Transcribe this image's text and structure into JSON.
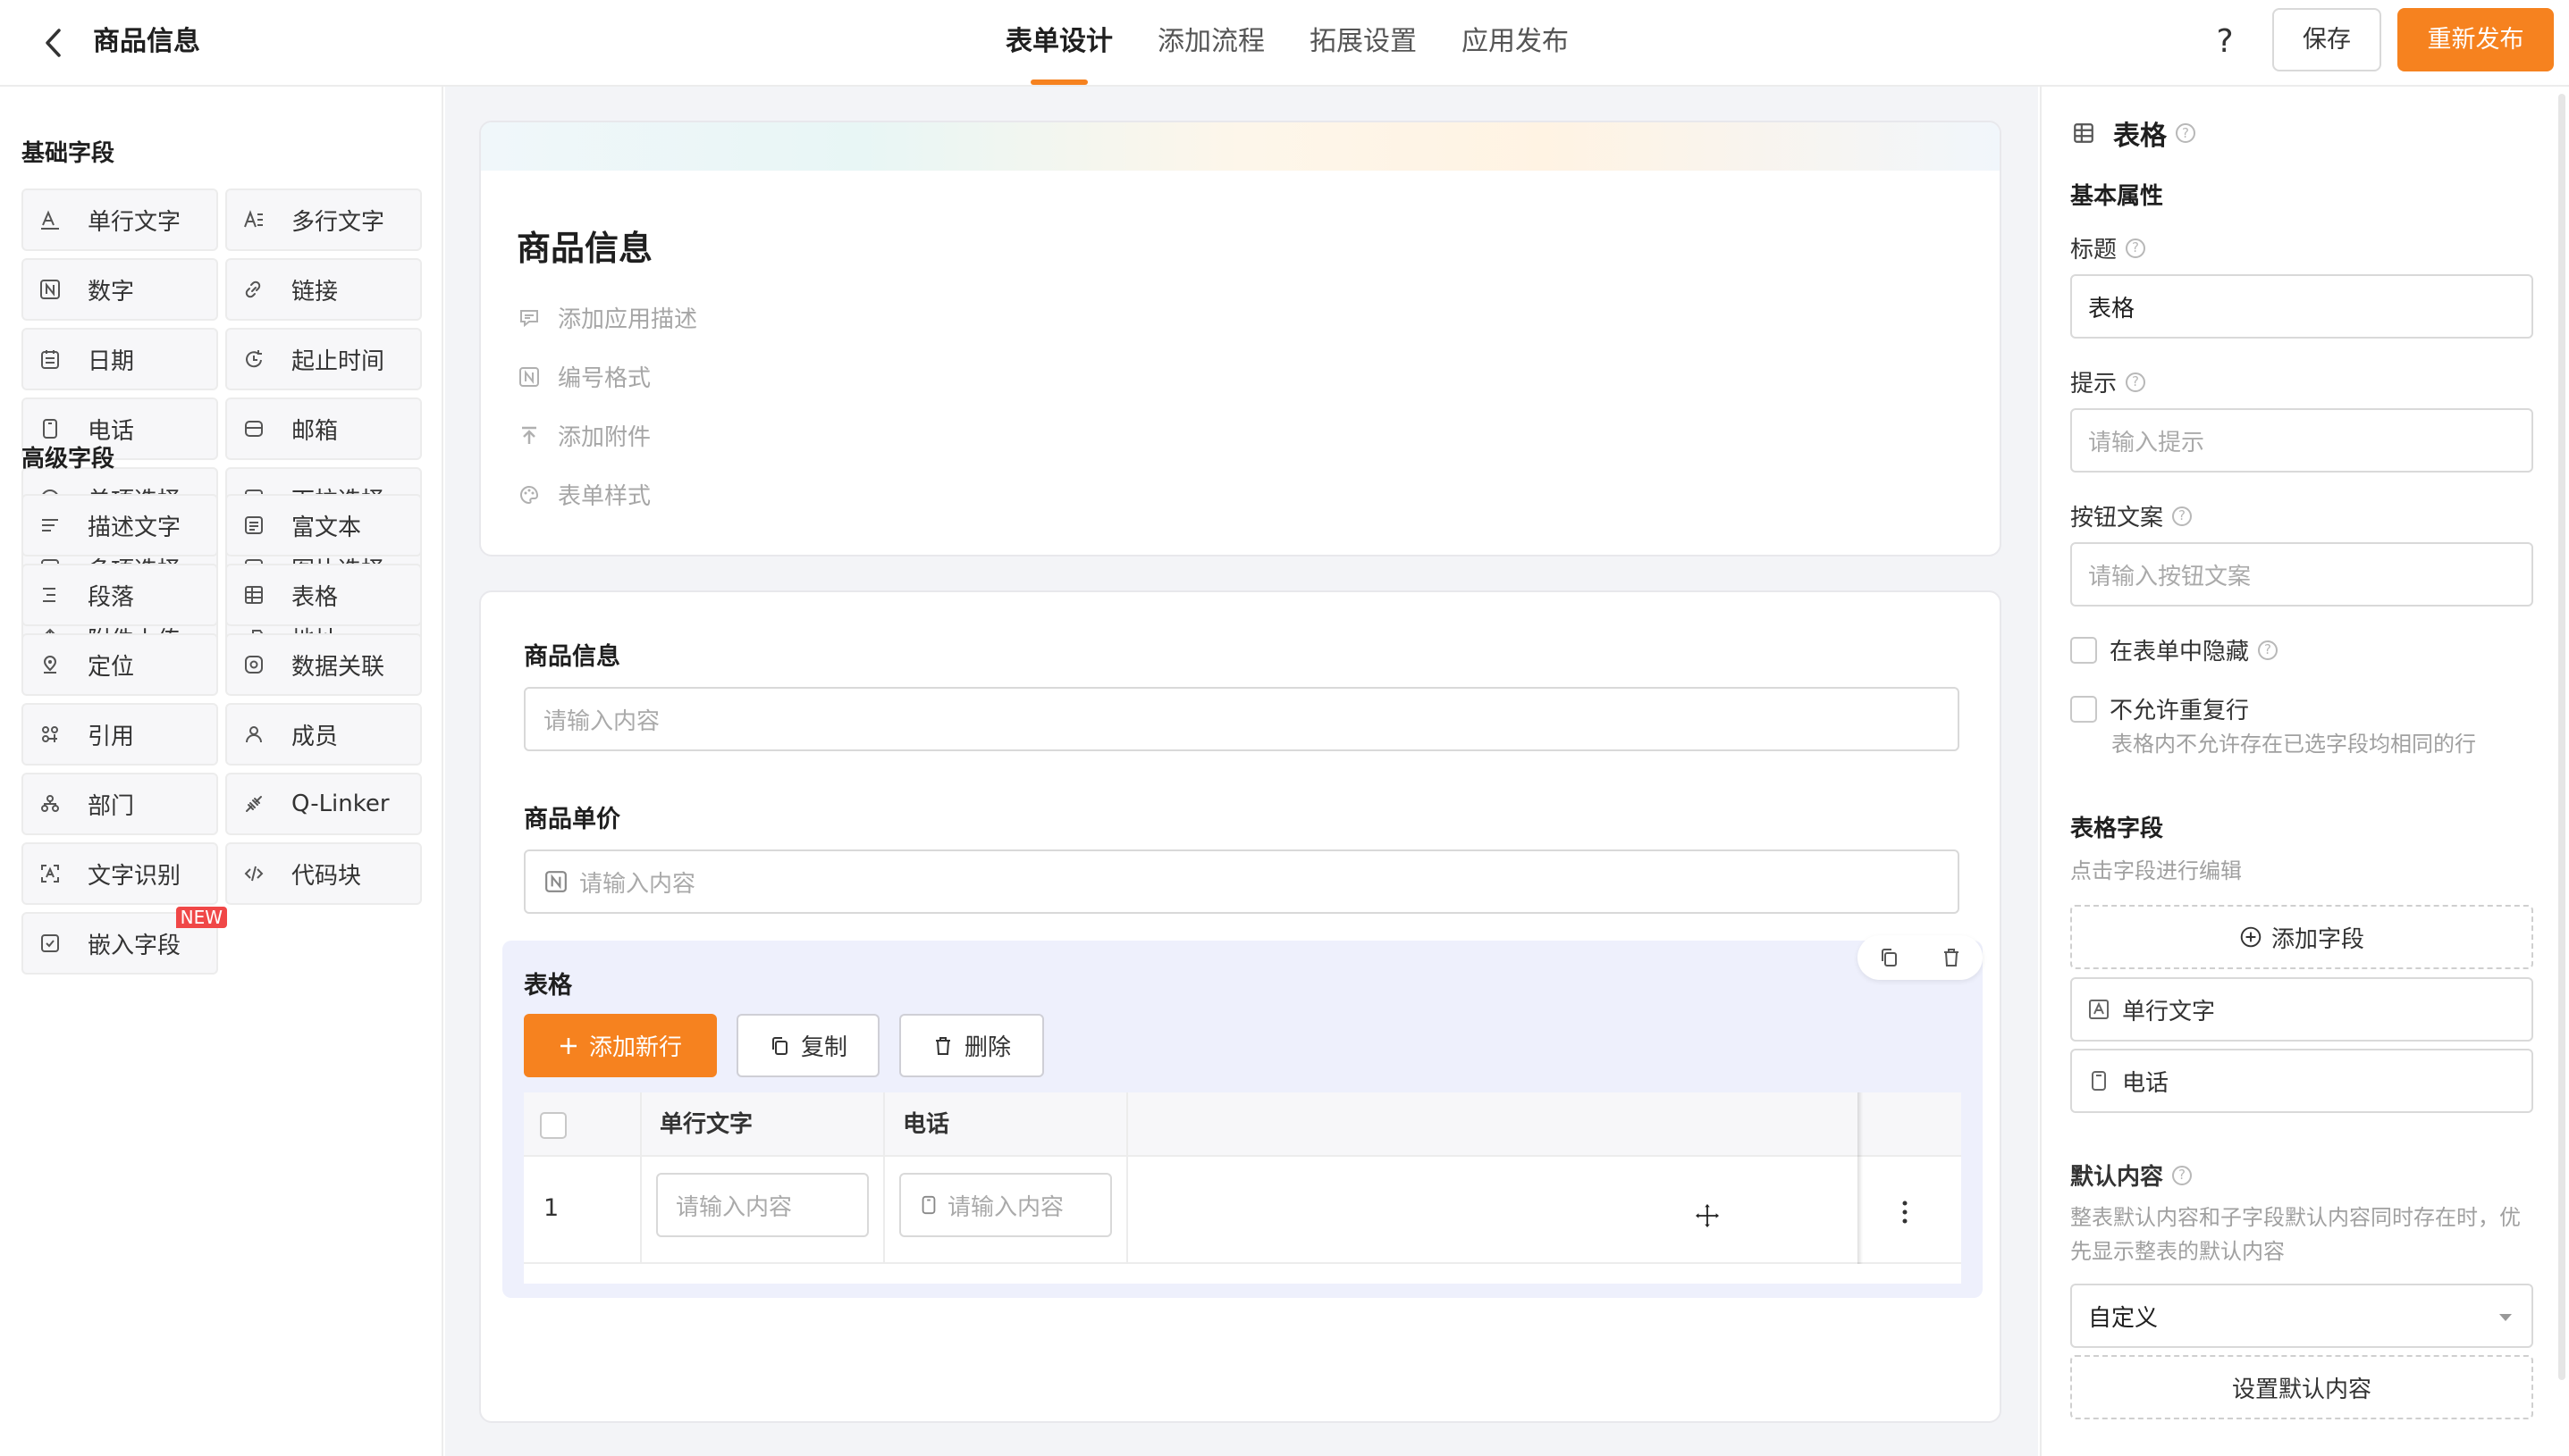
{
  "header": {
    "app_title": "商品信息",
    "tabs": [
      {
        "label": "表单设计",
        "active": true
      },
      {
        "label": "添加流程",
        "active": false
      },
      {
        "label": "拓展设置",
        "active": false
      },
      {
        "label": "应用发布",
        "active": false
      }
    ],
    "help_label": "?",
    "save_label": "保存",
    "publish_label": "重新发布",
    "accent_color": "#f6821f"
  },
  "left_panel": {
    "basic_title": "基础字段",
    "basic_fields": [
      {
        "label": "单行文字",
        "icon": "single-line-text-icon"
      },
      {
        "label": "多行文字",
        "icon": "multi-line-text-icon"
      },
      {
        "label": "数字",
        "icon": "number-icon"
      },
      {
        "label": "链接",
        "icon": "link-icon"
      },
      {
        "label": "日期",
        "icon": "date-icon"
      },
      {
        "label": "起止时间",
        "icon": "time-range-icon"
      },
      {
        "label": "电话",
        "icon": "phone-icon"
      },
      {
        "label": "邮箱",
        "icon": "mail-icon"
      },
      {
        "label": "单项选择",
        "icon": "radio-icon"
      },
      {
        "label": "下拉选择",
        "icon": "dropdown-icon"
      },
      {
        "label": "多项选择",
        "icon": "checkbox-icon"
      },
      {
        "label": "图片选择",
        "icon": "image-icon"
      },
      {
        "label": "附件上传",
        "icon": "upload-icon"
      },
      {
        "label": "地址",
        "icon": "address-icon"
      }
    ],
    "advanced_title": "高级字段",
    "advanced_fields": [
      {
        "label": "描述文字",
        "icon": "description-icon"
      },
      {
        "label": "富文本",
        "icon": "rich-text-icon"
      },
      {
        "label": "段落",
        "icon": "paragraph-icon"
      },
      {
        "label": "表格",
        "icon": "table-icon"
      },
      {
        "label": "定位",
        "icon": "location-icon"
      },
      {
        "label": "数据关联",
        "icon": "data-link-icon"
      },
      {
        "label": "引用",
        "icon": "reference-icon"
      },
      {
        "label": "成员",
        "icon": "member-icon"
      },
      {
        "label": "部门",
        "icon": "department-icon"
      },
      {
        "label": "Q-Linker",
        "icon": "q-linker-icon"
      },
      {
        "label": "文字识别",
        "icon": "ocr-icon"
      },
      {
        "label": "代码块",
        "icon": "code-icon"
      },
      {
        "label": "嵌入字段",
        "icon": "embed-icon",
        "badge": "NEW"
      }
    ]
  },
  "canvas": {
    "form_title": "商品信息",
    "meta": [
      {
        "label": "添加应用描述",
        "icon": "comment-icon"
      },
      {
        "label": "编号格式",
        "icon": "number-format-icon"
      },
      {
        "label": "添加附件",
        "icon": "attachment-upload-icon"
      },
      {
        "label": "表单样式",
        "icon": "palette-icon"
      }
    ],
    "fields": [
      {
        "label": "商品信息",
        "placeholder": "请输入内容"
      },
      {
        "label": "商品单价",
        "placeholder": "请输入内容"
      }
    ],
    "table": {
      "label": "表格",
      "add_row_label": "添加新行",
      "copy_label": "复制",
      "delete_label": "删除",
      "columns": [
        "单行文字",
        "电话"
      ],
      "rows": [
        {
          "index": "1",
          "cells": [
            "请输入内容",
            "请输入内容"
          ]
        }
      ]
    }
  },
  "right_panel": {
    "title": "表格",
    "basic_section": "基本属性",
    "title_label": "标题",
    "title_value": "表格",
    "hint_label": "提示",
    "hint_placeholder": "请输入提示",
    "button_text_label": "按钮文案",
    "button_text_placeholder": "请输入按钮文案",
    "hide_in_form": "在表单中隐藏",
    "no_duplicate": "不允许重复行",
    "no_duplicate_hint": "表格内不允许存在已选字段均相同的行",
    "table_fields_section": "表格字段",
    "table_fields_hint": "点击字段进行编辑",
    "add_field_label": "添加字段",
    "table_fields": [
      {
        "label": "单行文字",
        "icon": "single-line-text-icon"
      },
      {
        "label": "电话",
        "icon": "phone-icon"
      }
    ],
    "default_section": "默认内容",
    "default_hint": "整表默认内容和子字段默认内容同时存在时，优先显示整表的默认内容",
    "default_select_value": "自定义",
    "set_default_label": "设置默认内容"
  }
}
